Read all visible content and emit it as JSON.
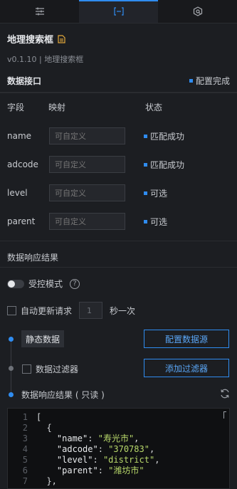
{
  "tabs": [
    {
      "name": "settings-tab",
      "icon": "sliders-icon"
    },
    {
      "name": "data-tab",
      "icon": "bracket-icon",
      "active": true
    },
    {
      "name": "interaction-tab",
      "icon": "refresh-diamond-icon"
    }
  ],
  "header": {
    "title": "地理搜索框",
    "subtitle": "v0.1.10 | 地理搜索框"
  },
  "data_api": {
    "title": "数据接口",
    "status": "配置完成"
  },
  "columns": [
    "字段",
    "映射",
    "状态"
  ],
  "fields": [
    {
      "name": "name",
      "placeholder": "可自定义",
      "status": "匹配成功"
    },
    {
      "name": "adcode",
      "placeholder": "可自定义",
      "status": "匹配成功"
    },
    {
      "name": "level",
      "placeholder": "可自定义",
      "status": "可选"
    },
    {
      "name": "parent",
      "placeholder": "可自定义",
      "status": "可选"
    }
  ],
  "response": {
    "title": "数据响应结果",
    "controlled_mode": "受控模式",
    "auto_update": "自动更新请求",
    "interval": "1",
    "interval_unit": "秒一次"
  },
  "pipeline": {
    "static_data": "静态数据",
    "config_source": "配置数据源",
    "data_filter": "数据过滤器",
    "add_filter": "添加过滤器",
    "result_readonly": "数据响应结果 ( 只读 )"
  },
  "code_lines": [
    {
      "n": "1",
      "text": "["
    },
    {
      "n": "2",
      "text": "  {"
    },
    {
      "n": "3",
      "key": "\"name\"",
      "val": "\"寿光市\""
    },
    {
      "n": "4",
      "key": "\"adcode\"",
      "val": "\"370783\""
    },
    {
      "n": "5",
      "key": "\"level\"",
      "val": "\"district\""
    },
    {
      "n": "6",
      "key": "\"parent\"",
      "val": "\"潍坊市\"",
      "last": true
    },
    {
      "n": "7",
      "text": "  },"
    }
  ],
  "colors": {
    "accent": "#2f8cf0",
    "bg": "#1c1e22",
    "string": "#b8d86a"
  }
}
